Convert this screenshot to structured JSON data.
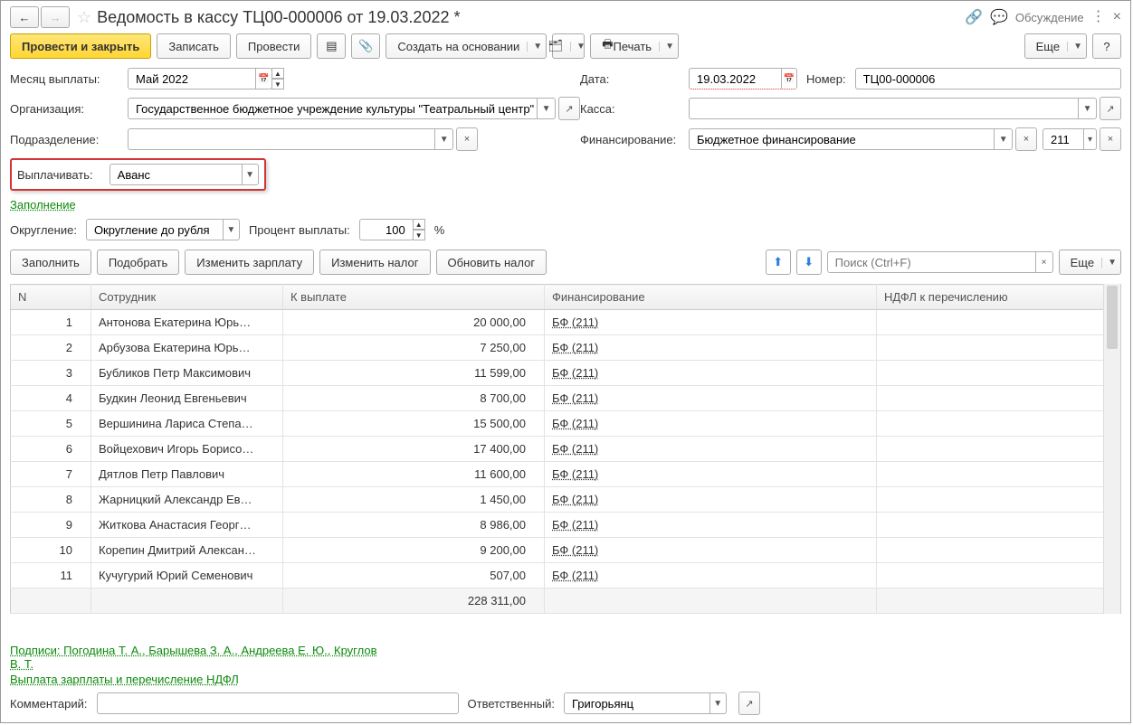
{
  "header": {
    "title": "Ведомость в кассу ТЦ00-000006 от 19.03.2022 *",
    "discussion": "Обсуждение"
  },
  "toolbar": {
    "post_close": "Провести и закрыть",
    "save": "Записать",
    "post": "Провести",
    "create_based": "Создать на основании",
    "print": "Печать",
    "more": "Еще",
    "help": "?"
  },
  "form": {
    "month_label": "Месяц выплаты:",
    "month_value": "Май 2022",
    "date_label": "Дата:",
    "date_value": "19.03.2022",
    "number_label": "Номер:",
    "number_value": "ТЦ00-000006",
    "org_label": "Организация:",
    "org_value": "Государственное бюджетное учреждение культуры \"Театральный центр\"",
    "cash_label": "Касса:",
    "cash_value": "",
    "dept_label": "Подразделение:",
    "dept_value": "",
    "fin_label": "Финансирование:",
    "fin_value": "Бюджетное финансирование",
    "fin_code": "211",
    "pay_label": "Выплачивать:",
    "pay_value": "Аванс"
  },
  "fill_link": "Заполнение",
  "rounding": {
    "label": "Округление:",
    "value": "Округление до рубля",
    "percent_label": "Процент выплаты:",
    "percent_value": "100",
    "percent_suffix": "%"
  },
  "tablebar": {
    "fill": "Заполнить",
    "pick": "Подобрать",
    "change_salary": "Изменить зарплату",
    "change_tax": "Изменить налог",
    "update_tax": "Обновить налог",
    "search_placeholder": "Поиск (Ctrl+F)",
    "more": "Еще"
  },
  "columns": {
    "n": "N",
    "employee": "Сотрудник",
    "to_pay": "К выплате",
    "financing": "Финансирование",
    "ndfl": "НДФЛ к перечислению"
  },
  "rows": [
    {
      "n": "1",
      "emp": "Антонова Екатерина Юрь…",
      "pay": "20 000,00",
      "fin": "БФ (211)"
    },
    {
      "n": "2",
      "emp": "Арбузова Екатерина Юрь…",
      "pay": "7 250,00",
      "fin": "БФ (211)"
    },
    {
      "n": "3",
      "emp": "Бубликов Петр Максимович",
      "pay": "11 599,00",
      "fin": "БФ (211)"
    },
    {
      "n": "4",
      "emp": "Будкин Леонид Евгеньевич",
      "pay": "8 700,00",
      "fin": "БФ (211)"
    },
    {
      "n": "5",
      "emp": "Вершинина Лариса Степа…",
      "pay": "15 500,00",
      "fin": "БФ (211)"
    },
    {
      "n": "6",
      "emp": "Войцехович Игорь Борисо…",
      "pay": "17 400,00",
      "fin": "БФ (211)"
    },
    {
      "n": "7",
      "emp": "Дятлов Петр Павлович",
      "pay": "11 600,00",
      "fin": "БФ (211)"
    },
    {
      "n": "8",
      "emp": "Жарницкий Александр Ев…",
      "pay": "1 450,00",
      "fin": "БФ (211)"
    },
    {
      "n": "9",
      "emp": "Житкова Анастасия Георг…",
      "pay": "8 986,00",
      "fin": "БФ (211)"
    },
    {
      "n": "10",
      "emp": "Корепин Дмитрий Алексан…",
      "pay": "9 200,00",
      "fin": "БФ (211)"
    },
    {
      "n": "11",
      "emp": "Кучугурий Юрий Семенович",
      "pay": "507,00",
      "fin": "БФ (211)"
    }
  ],
  "total_pay": "228 311,00",
  "footer": {
    "sign_link": "Подписи: Погодина Т. А., Барышева З. А., Андреева Е. Ю., Круглов В. Т.",
    "pay_link": "Выплата зарплаты и перечисление НДФЛ",
    "comment_label": "Комментарий:",
    "resp_label": "Ответственный:",
    "resp_value": "Григорьянц"
  }
}
